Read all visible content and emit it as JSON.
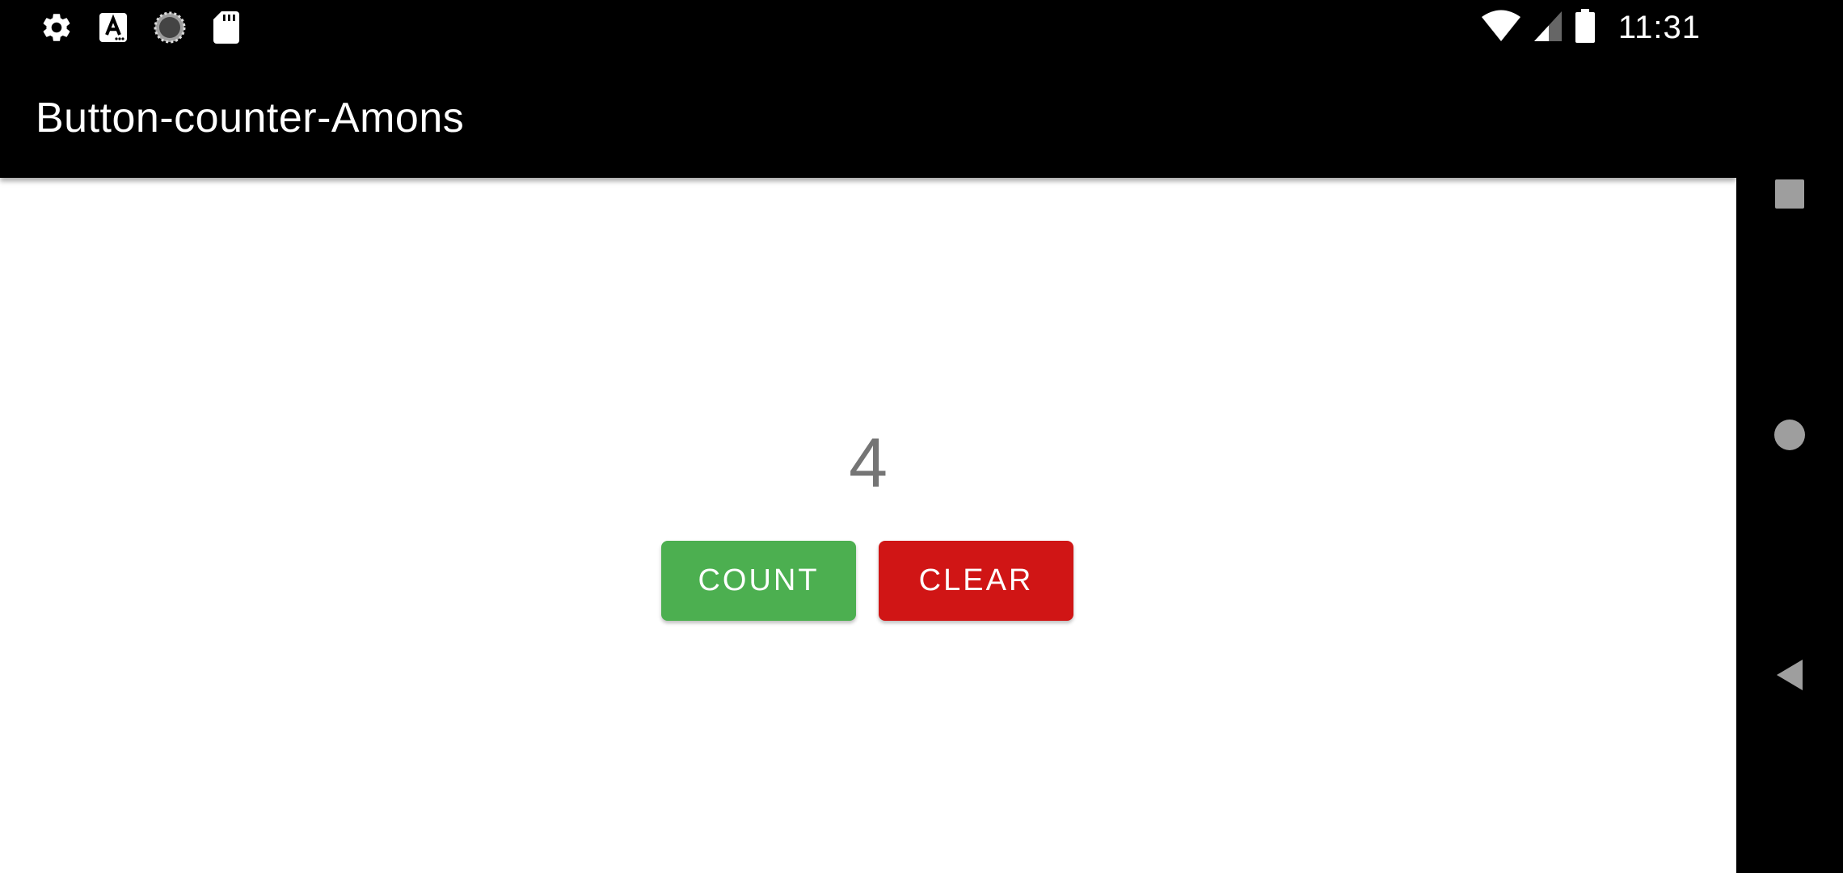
{
  "status_bar": {
    "time": "11:31",
    "left_icons": [
      "gear-icon",
      "text-a-icon",
      "loading-circle-icon",
      "sd-card-icon"
    ],
    "right_icons": [
      "wifi-icon",
      "cell-signal-icon",
      "battery-icon"
    ]
  },
  "app_bar": {
    "title": "Button-counter-Amons"
  },
  "counter": {
    "value": "4"
  },
  "buttons": {
    "count_label": "COUNT",
    "clear_label": "CLEAR"
  },
  "colors": {
    "count_button": "#4caf50",
    "clear_button": "#d01515",
    "counter_text": "#757575",
    "app_bar": "#000000"
  },
  "nav_bar": {
    "icons": [
      "recents-square-icon",
      "home-circle-icon",
      "back-triangle-icon"
    ]
  }
}
